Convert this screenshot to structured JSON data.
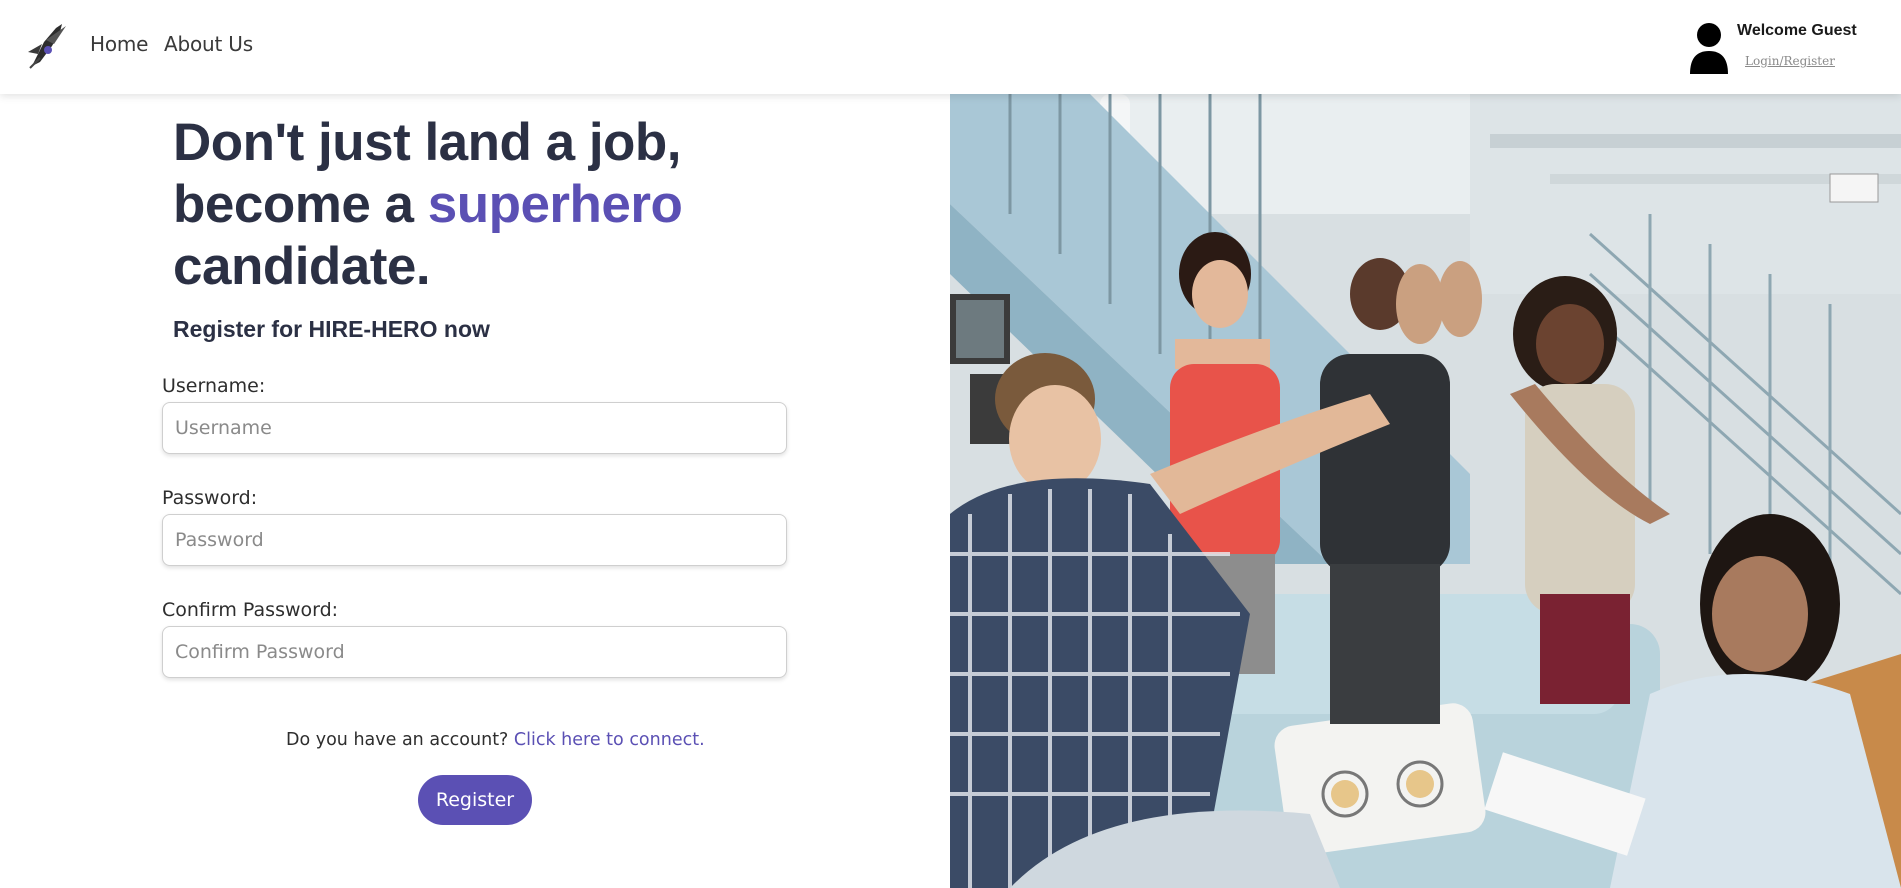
{
  "nav": {
    "links": [
      {
        "label": "Home"
      },
      {
        "label": "About Us"
      }
    ],
    "user": {
      "welcome": "Welcome Guest",
      "login_link": "Login/Register"
    }
  },
  "hero": {
    "line1": "Don't just land a job,",
    "line2_prefix": "become a ",
    "line2_accent": "superhero",
    "line3": "candidate.",
    "subtitle": "Register for HIRE-HERO now"
  },
  "form": {
    "username": {
      "label": "Username:",
      "placeholder": "Username",
      "value": ""
    },
    "password": {
      "label": "Password:",
      "placeholder": "Password",
      "value": ""
    },
    "confirm": {
      "label": "Confirm Password:",
      "placeholder": "Confirm Password",
      "value": ""
    },
    "account_question": "Do you have an account? ",
    "account_link": "Click here to connect.",
    "submit_label": "Register"
  },
  "colors": {
    "accent": "#5b50b4",
    "heading": "#2b3044"
  },
  "icons": {
    "logo": "superhero-logo-icon",
    "avatar": "user-avatar-icon"
  }
}
